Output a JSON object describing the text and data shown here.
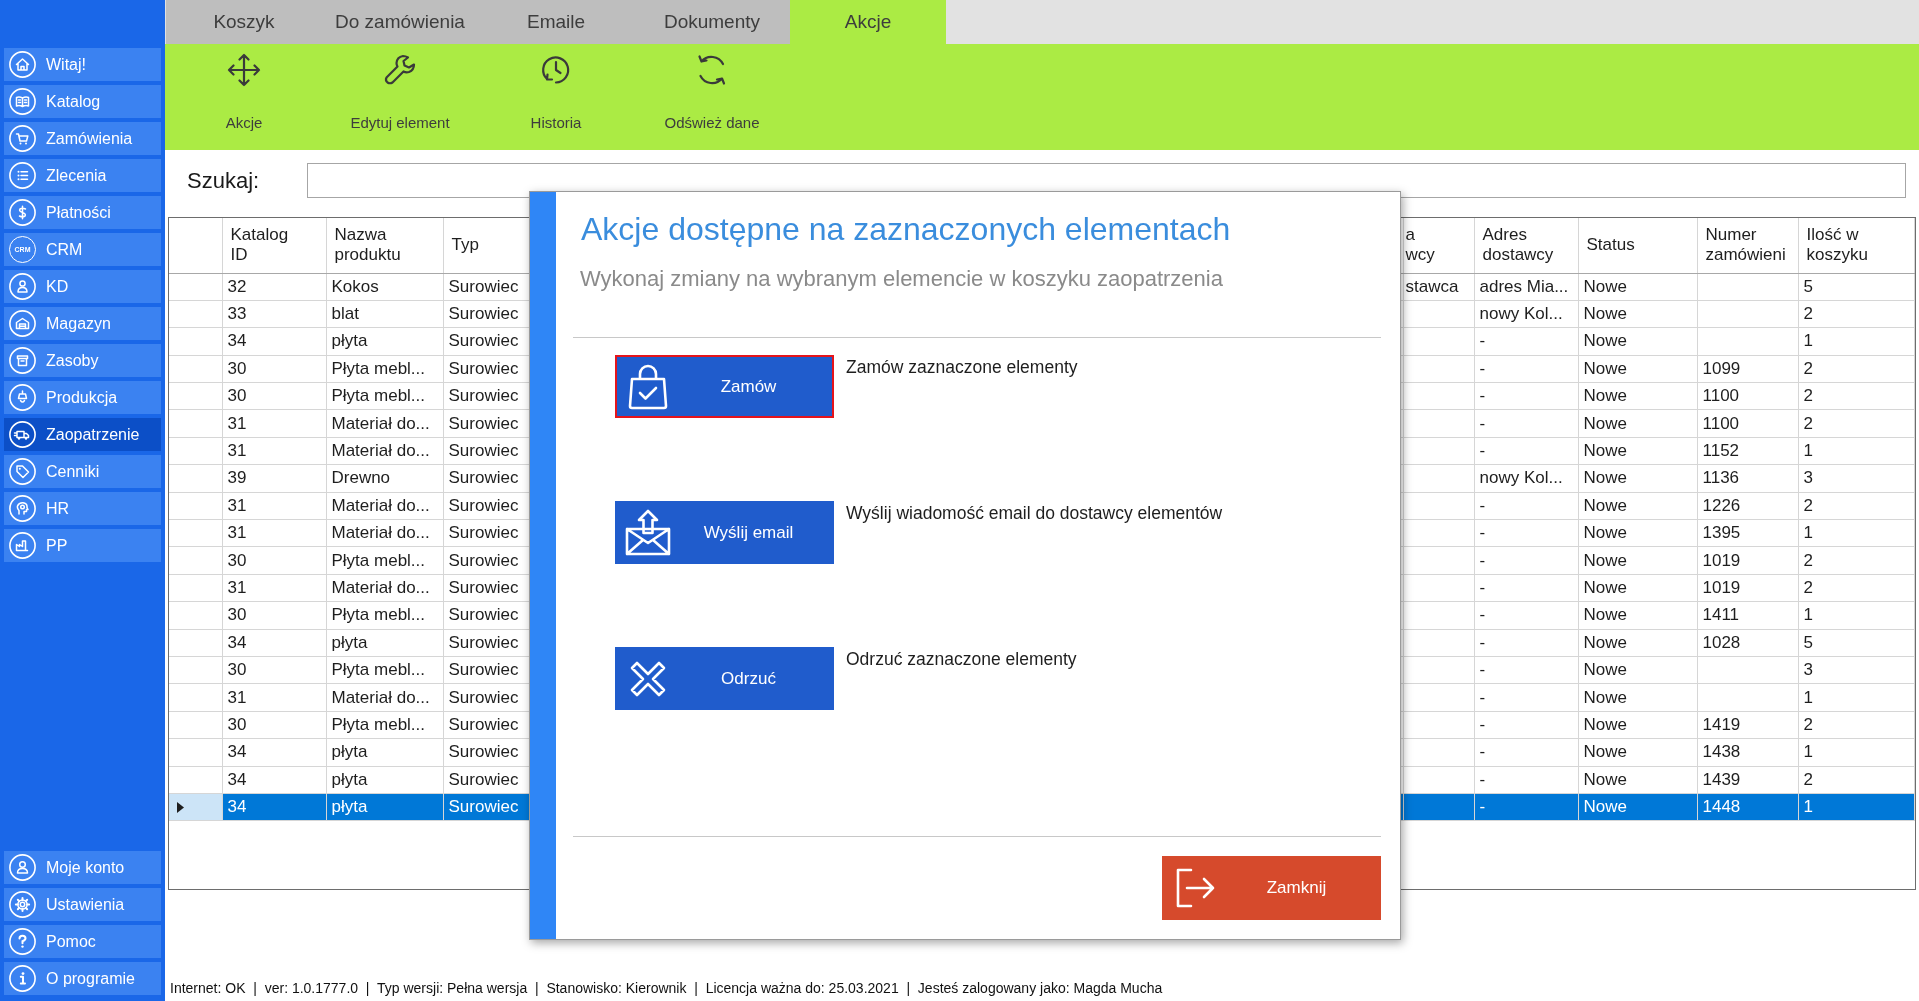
{
  "sidebar": {
    "items": [
      {
        "label": "Witaj!",
        "selected": false
      },
      {
        "label": "Katalog",
        "selected": false
      },
      {
        "label": "Zamówienia",
        "selected": false
      },
      {
        "label": "Zlecenia",
        "selected": false
      },
      {
        "label": "Płatności",
        "selected": false
      },
      {
        "label": "CRM",
        "icon_text": "CRM",
        "selected": false
      },
      {
        "label": "KD",
        "selected": false
      },
      {
        "label": "Magazyn",
        "selected": false
      },
      {
        "label": "Zasoby",
        "selected": false
      },
      {
        "label": "Produkcja",
        "selected": false
      },
      {
        "label": "Zaopatrzenie",
        "selected": true
      },
      {
        "label": "Cenniki",
        "selected": false
      },
      {
        "label": "HR",
        "selected": false
      },
      {
        "label": "PP",
        "selected": false
      }
    ],
    "footer_items": [
      {
        "label": "Moje konto",
        "selected": false
      },
      {
        "label": "Ustawienia",
        "selected": false
      },
      {
        "label": "Pomoc",
        "selected": false
      },
      {
        "label": "O programie",
        "selected": false
      }
    ]
  },
  "tabs": [
    {
      "label": "Koszyk",
      "selected": false
    },
    {
      "label": "Do zamówienia",
      "selected": false
    },
    {
      "label": "Emaile",
      "selected": false
    },
    {
      "label": "Dokumenty",
      "selected": false
    },
    {
      "label": "Akcje",
      "selected": true
    }
  ],
  "toolbar": {
    "buttons": [
      {
        "label": "Akcje"
      },
      {
        "label": "Edytuj element"
      },
      {
        "label": "Historia"
      },
      {
        "label": "Odśwież dane"
      }
    ]
  },
  "search": {
    "label": "Szukaj:"
  },
  "table": {
    "columns": [
      {
        "label": "Katalog ID"
      },
      {
        "label": "Nazwa produktu"
      },
      {
        "label": "Typ"
      },
      {
        "label": "a wcy"
      },
      {
        "label": "Adres dostawcy"
      },
      {
        "label": "Status"
      },
      {
        "label": "Numer zamówieni"
      },
      {
        "label": "Ilość w koszyku"
      }
    ],
    "rows": [
      {
        "katalog_id": "32",
        "nazwa_produktu": "Kokos",
        "typ": "Surowiec",
        "column_5": "stawca",
        "adres_dostawcy": "adres Mia...",
        "status": "Nowe",
        "ilosc_w_koszyku": "5",
        "selected": false
      },
      {
        "katalog_id": "33",
        "nazwa_produktu": "blat",
        "typ": "Surowiec",
        "adres_dostawcy": "nowy Kol...",
        "status": "Nowe",
        "ilosc_w_koszyku": "2",
        "selected": false
      },
      {
        "katalog_id": "34",
        "nazwa_produktu": "płyta",
        "typ": "Surowiec",
        "adres_dostawcy": "-",
        "status": "Nowe",
        "ilosc_w_koszyku": "1",
        "selected": false
      },
      {
        "katalog_id": "30",
        "nazwa_produktu": "Płyta mebl...",
        "typ": "Surowiec",
        "adres_dostawcy": "-",
        "status": "Nowe",
        "numer_zamowienia": "1099",
        "ilosc_w_koszyku": "2",
        "selected": false
      },
      {
        "katalog_id": "30",
        "nazwa_produktu": "Płyta mebl...",
        "typ": "Surowiec",
        "adres_dostawcy": "-",
        "status": "Nowe",
        "numer_zamowienia": "1100",
        "ilosc_w_koszyku": "2",
        "selected": false
      },
      {
        "katalog_id": "31",
        "nazwa_produktu": "Materiał do...",
        "typ": "Surowiec",
        "adres_dostawcy": "-",
        "status": "Nowe",
        "numer_zamowienia": "1100",
        "ilosc_w_koszyku": "2",
        "selected": false
      },
      {
        "katalog_id": "31",
        "nazwa_produktu": "Materiał do...",
        "typ": "Surowiec",
        "adres_dostawcy": "-",
        "status": "Nowe",
        "numer_zamowienia": "1152",
        "ilosc_w_koszyku": "1",
        "selected": false
      },
      {
        "katalog_id": "39",
        "nazwa_produktu": "Drewno",
        "typ": "Surowiec",
        "adres_dostawcy": "nowy Kol...",
        "status": "Nowe",
        "numer_zamowienia": "1136",
        "ilosc_w_koszyku": "3",
        "selected": false
      },
      {
        "katalog_id": "31",
        "nazwa_produktu": "Materiał do...",
        "typ": "Surowiec",
        "adres_dostawcy": "-",
        "status": "Nowe",
        "numer_zamowienia": "1226",
        "ilosc_w_koszyku": "2",
        "selected": false
      },
      {
        "katalog_id": "31",
        "nazwa_produktu": "Materiał do...",
        "typ": "Surowiec",
        "adres_dostawcy": "-",
        "status": "Nowe",
        "numer_zamowienia": "1395",
        "ilosc_w_koszyku": "1",
        "selected": false
      },
      {
        "katalog_id": "30",
        "nazwa_produktu": "Płyta mebl...",
        "typ": "Surowiec",
        "adres_dostawcy": "-",
        "status": "Nowe",
        "numer_zamowienia": "1019",
        "ilosc_w_koszyku": "2",
        "selected": false
      },
      {
        "katalog_id": "31",
        "nazwa_produktu": "Materiał do...",
        "typ": "Surowiec",
        "adres_dostawcy": "-",
        "status": "Nowe",
        "numer_zamowienia": "1019",
        "ilosc_w_koszyku": "2",
        "selected": false
      },
      {
        "katalog_id": "30",
        "nazwa_produktu": "Płyta mebl...",
        "typ": "Surowiec",
        "adres_dostawcy": "-",
        "status": "Nowe",
        "numer_zamowienia": "1411",
        "ilosc_w_koszyku": "1",
        "selected": false
      },
      {
        "katalog_id": "34",
        "nazwa_produktu": "płyta",
        "typ": "Surowiec",
        "adres_dostawcy": "-",
        "status": "Nowe",
        "numer_zamowienia": "1028",
        "ilosc_w_koszyku": "5",
        "selected": false
      },
      {
        "katalog_id": "30",
        "nazwa_produktu": "Płyta mebl...",
        "typ": "Surowiec",
        "adres_dostawcy": "-",
        "status": "Nowe",
        "ilosc_w_koszyku": "3",
        "selected": false
      },
      {
        "katalog_id": "31",
        "nazwa_produktu": "Materiał do...",
        "typ": "Surowiec",
        "adres_dostawcy": "-",
        "status": "Nowe",
        "ilosc_w_koszyku": "1",
        "selected": false
      },
      {
        "katalog_id": "30",
        "nazwa_produktu": "Płyta mebl...",
        "typ": "Surowiec",
        "adres_dostawcy": "-",
        "status": "Nowe",
        "numer_zamowienia": "1419",
        "ilosc_w_koszyku": "2",
        "selected": false
      },
      {
        "katalog_id": "34",
        "nazwa_produktu": "płyta",
        "typ": "Surowiec",
        "adres_dostawcy": "-",
        "status": "Nowe",
        "numer_zamowienia": "1438",
        "ilosc_w_koszyku": "1",
        "selected": false
      },
      {
        "katalog_id": "34",
        "nazwa_produktu": "płyta",
        "typ": "Surowiec",
        "adres_dostawcy": "-",
        "status": "Nowe",
        "numer_zamowienia": "1439",
        "ilosc_w_koszyku": "2",
        "selected": false
      },
      {
        "katalog_id": "34",
        "nazwa_produktu": "płyta",
        "typ": "Surowiec",
        "adres_dostawcy": "-",
        "status": "Nowe",
        "numer_zamowienia": "1448",
        "ilosc_w_koszyku": "1",
        "selected": true
      }
    ]
  },
  "dialog": {
    "title": "Akcje dostępne na zaznaczonych elementach",
    "subtitle": "Wykonaj zmiany na wybranym elemencie w koszyku zaopatrzenia",
    "actions": [
      {
        "label": "Zamów",
        "description": "Zamów zaznaczone elementy",
        "focused": true
      },
      {
        "label": "Wyślij email",
        "description": "Wyślij wiadomość email do dostawcy elementów",
        "focused": false
      },
      {
        "label": "Odrzuć",
        "description": "Odrzuć zaznaczone elementy",
        "focused": false
      }
    ],
    "close_button": {
      "label": "Zamknij"
    }
  },
  "status_bar": {
    "text": "Internet: OK  |  ver: 1.0.1777.0  |  Typ wersji: Pełna wersja  |  Stanowisko: Kierownik  |  Licencja ważna do: 25.03.2021  |  Jesteś zalogowany jako: Magda Mucha"
  }
}
